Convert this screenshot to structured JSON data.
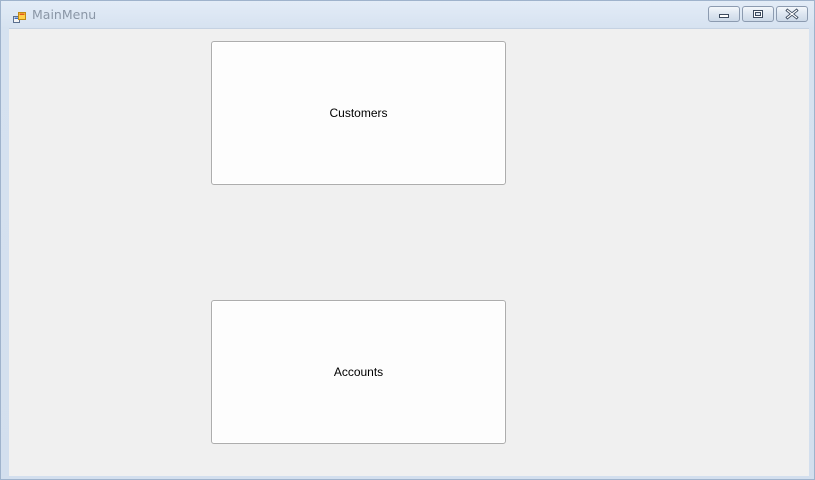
{
  "window": {
    "title": "MainMenu",
    "controls": {
      "minimize_icon": "minimize-icon",
      "maximize_icon": "restore-icon",
      "close_icon": "close-icon"
    }
  },
  "main": {
    "buttons": [
      {
        "label": "Customers"
      },
      {
        "label": "Accounts"
      }
    ]
  },
  "colors": {
    "titlebar": "#dce7f3",
    "client_background": "#f0f0f0",
    "button_face": "#fdfdfd",
    "button_border": "#adadad",
    "title_text": "#8a96a6"
  }
}
